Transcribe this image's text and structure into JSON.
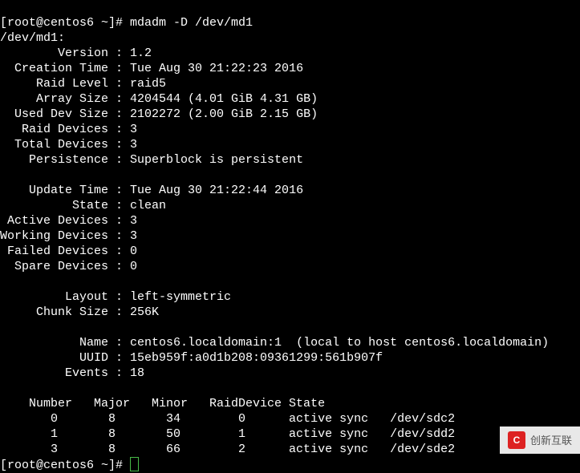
{
  "prompt1": "[root@centos6 ~]# mdadm -D /dev/md1",
  "device": "/dev/md1:",
  "fields": {
    "version_label": "        Version : ",
    "version_value": "1.2",
    "creation_label": "  Creation Time : ",
    "creation_value": "Tue Aug 30 21:22:23 2016",
    "raidlevel_label": "     Raid Level : ",
    "raidlevel_value": "raid5",
    "arraysize_label": "     Array Size : ",
    "arraysize_value": "4204544 (4.01 GiB 4.31 GB)",
    "useddev_label": "  Used Dev Size : ",
    "useddev_value": "2102272 (2.00 GiB 2.15 GB)",
    "raiddev_label": "   Raid Devices : ",
    "raiddev_value": "3",
    "totaldev_label": "  Total Devices : ",
    "totaldev_value": "3",
    "persist_label": "    Persistence : ",
    "persist_value": "Superblock is persistent",
    "update_label": "    Update Time : ",
    "update_value": "Tue Aug 30 21:22:44 2016",
    "state_label": "          State : ",
    "state_value": "clean",
    "active_label": " Active Devices : ",
    "active_value": "3",
    "working_label": "Working Devices : ",
    "working_value": "3",
    "failed_label": " Failed Devices : ",
    "failed_value": "0",
    "spare_label": "  Spare Devices : ",
    "spare_value": "0",
    "layout_label": "         Layout : ",
    "layout_value": "left-symmetric",
    "chunk_label": "     Chunk Size : ",
    "chunk_value": "256K",
    "name_label": "           Name : ",
    "name_value": "centos6.localdomain:1  (local to host centos6.localdomain)",
    "uuid_label": "           UUID : ",
    "uuid_value": "15eb959f:a0d1b208:09361299:561b907f",
    "events_label": "         Events : ",
    "events_value": "18"
  },
  "table_header": "    Number   Major   Minor   RaidDevice State",
  "table_rows": [
    "       0       8       34        0      active sync   /dev/sdc2",
    "       1       8       50        1      active sync   /dev/sdd2",
    "       3       8       66        2      active sync   /dev/sde2"
  ],
  "prompt2": "[root@centos6 ~]# ",
  "watermark": {
    "icon_text": "C",
    "text": "创新互联"
  }
}
